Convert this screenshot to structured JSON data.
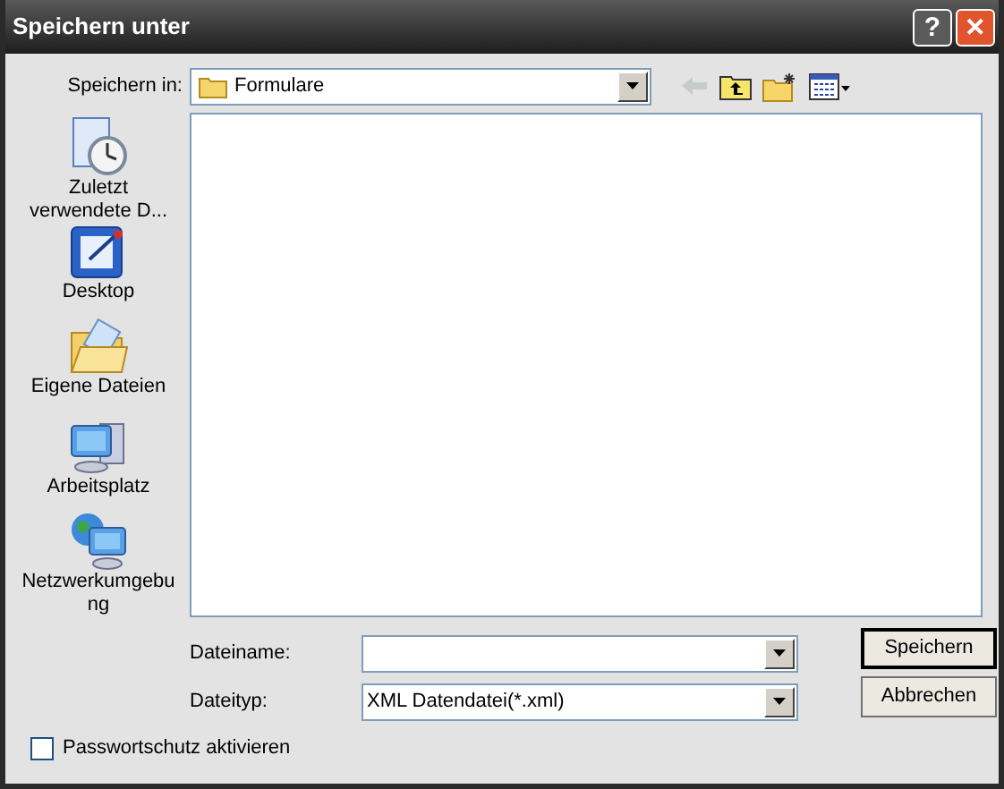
{
  "window": {
    "title": "Speichern unter"
  },
  "title_buttons": [
    {
      "kind": "help",
      "label": "?"
    },
    {
      "kind": "close",
      "label": "✕"
    }
  ],
  "save_in": {
    "label": "Speichern in:",
    "value": "Formulare"
  },
  "toolbar": [
    {
      "kind": "back",
      "disabled": true
    },
    {
      "kind": "up",
      "disabled": false
    },
    {
      "kind": "newfolder",
      "disabled": false
    },
    {
      "kind": "views",
      "disabled": false
    }
  ],
  "places": [
    {
      "kind": "recent",
      "label": "Zuletzt verwendete D..."
    },
    {
      "kind": "desktop",
      "label": "Desktop"
    },
    {
      "kind": "documents",
      "label": "Eigene Dateien"
    },
    {
      "kind": "computer",
      "label": "Arbeitsplatz"
    },
    {
      "kind": "network",
      "label": "Netzwerkumgebung"
    }
  ],
  "filename": {
    "label": "Dateiname:"
  },
  "filetype": {
    "label": "Dateityp:",
    "value": "XML Datendatei(*.xml)"
  },
  "buttons": [
    {
      "label": "Speichern",
      "default": true
    },
    {
      "label": "Abbrechen",
      "default": false
    }
  ],
  "password": {
    "label": "Passwortschutz aktivieren",
    "checked": false
  }
}
